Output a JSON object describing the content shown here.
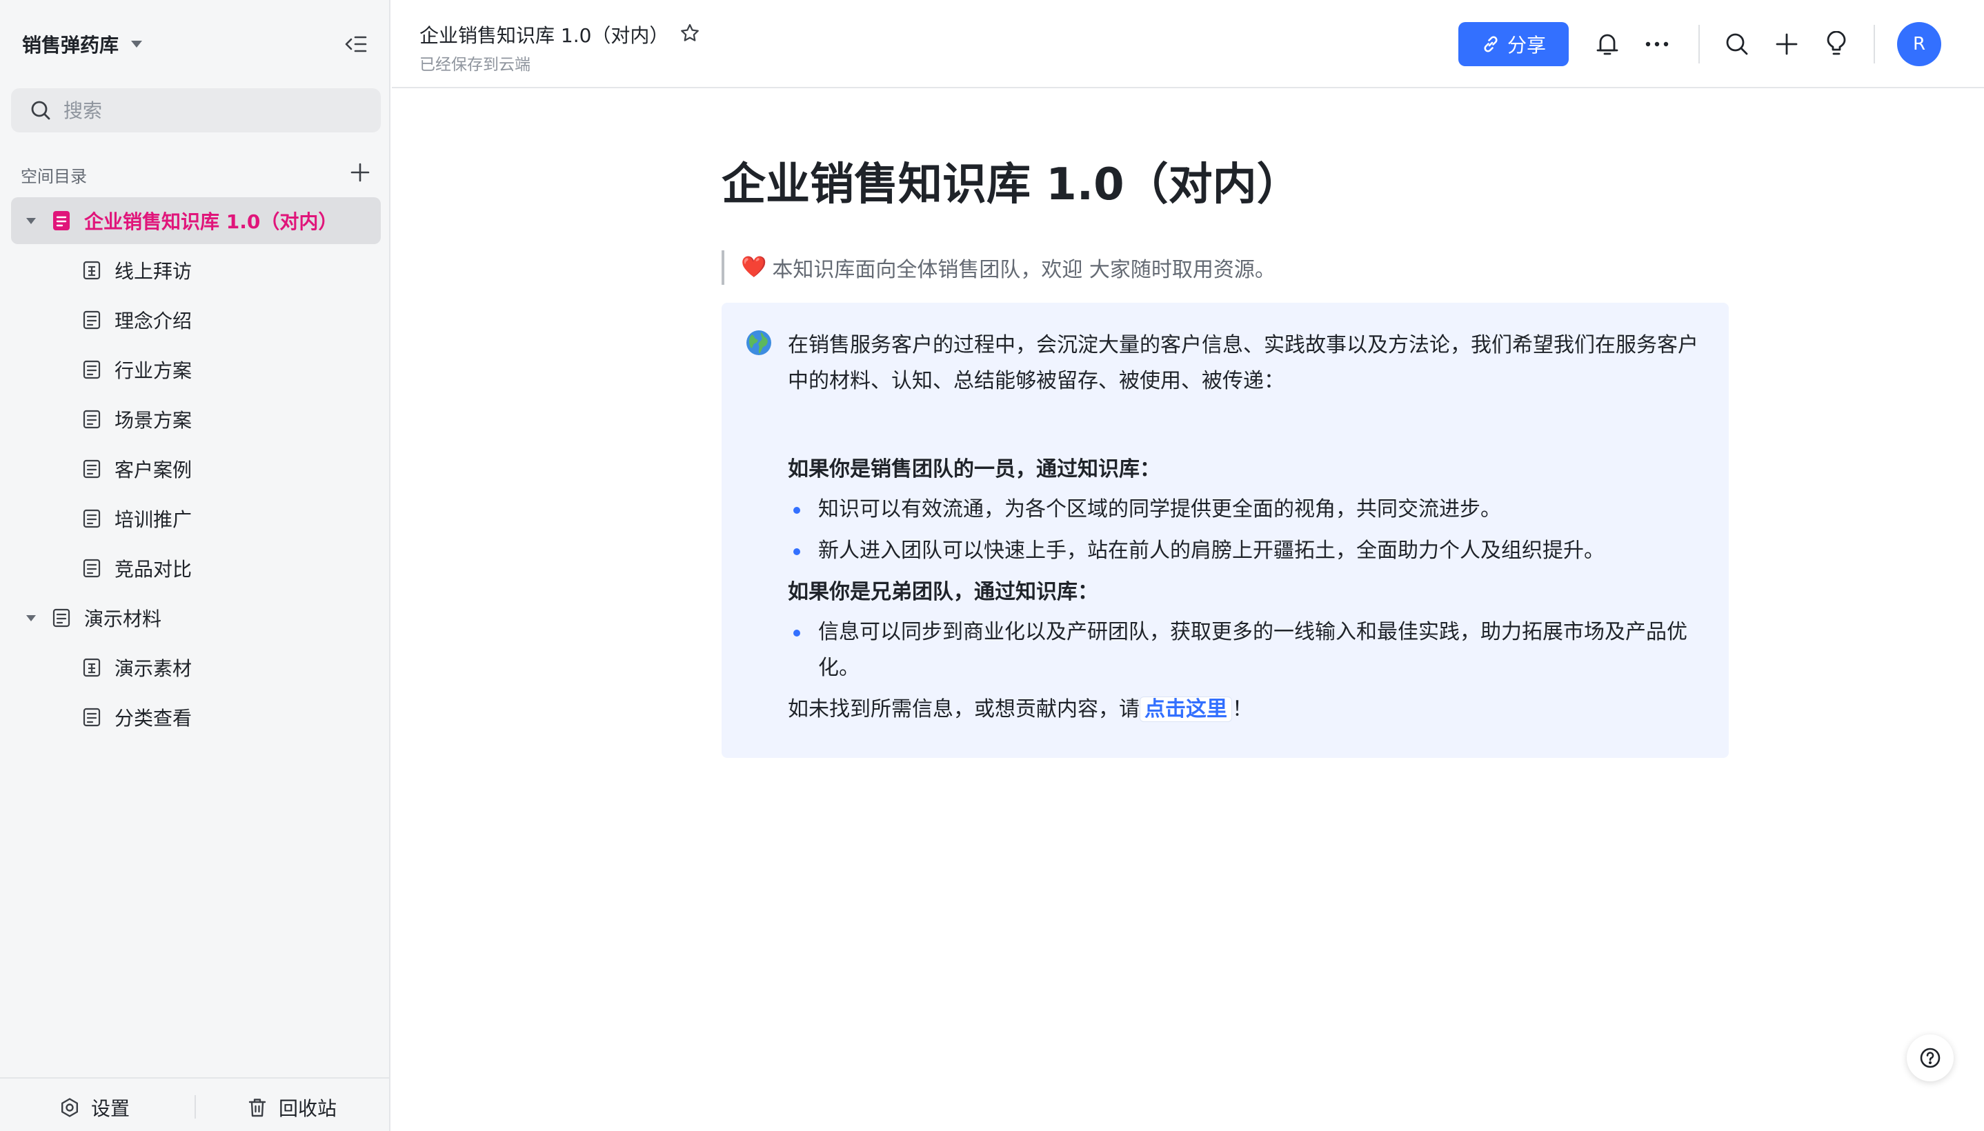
{
  "sidebar": {
    "space_name": "销售弹药库",
    "search_placeholder": "搜索",
    "directory_title": "空间目录",
    "items": [
      {
        "label": "企业销售知识库 1.0（对内）",
        "icon": "doc-pink-icon",
        "level": 0,
        "expanded": true,
        "active": true
      },
      {
        "label": "线上拜访",
        "icon": "table-icon",
        "level": 1
      },
      {
        "label": "理念介绍",
        "icon": "doc-icon",
        "level": 1
      },
      {
        "label": "行业方案",
        "icon": "doc-icon",
        "level": 1
      },
      {
        "label": "场景方案",
        "icon": "doc-icon",
        "level": 1
      },
      {
        "label": "客户案例",
        "icon": "doc-icon",
        "level": 1
      },
      {
        "label": "培训推广",
        "icon": "doc-icon",
        "level": 1
      },
      {
        "label": "竞品对比",
        "icon": "doc-icon",
        "level": 1
      },
      {
        "label": "演示材料",
        "icon": "doc-icon",
        "level": 0,
        "expanded": true
      },
      {
        "label": "演示素材",
        "icon": "table-icon",
        "level": 1
      },
      {
        "label": "分类查看",
        "icon": "doc-icon",
        "level": 1
      }
    ],
    "footer": {
      "settings_label": "设置",
      "trash_label": "回收站"
    }
  },
  "topbar": {
    "doc_title": "企业销售知识库 1.0（对内）",
    "save_status": "已经保存到云端",
    "share_label": "分享",
    "avatar_initial": "R",
    "accent_color": "#3370ff"
  },
  "document": {
    "title": "企业销售知识库 1.0（对内）",
    "quote_text": "本知识库面向全体销售团队，欢迎 大家随时取用资源。",
    "callout": {
      "intro": "在销售服务客户的过程中，会沉淀大量的客户信息、实践故事以及方法论，我们希望我们在服务客户中的材料、认知、总结能够被留存、被使用、被传递：",
      "section1_title": "如果你是销售团队的一员，通过知识库：",
      "section1_items": [
        "知识可以有效流通，为各个区域的同学提供更全面的视角，共同交流进步。",
        "新人进入团队可以快速上手，站在前人的肩膀上开疆拓土，全面助力个人及组织提升。"
      ],
      "section2_title": "如果你是兄弟团队，通过知识库：",
      "section2_items": [
        "信息可以同步到商业化以及产研团队，获取更多的一线输入和最佳实践，助力拓展市场及产品优化。"
      ],
      "footer_prefix": "如未找到所需信息，或想贡献内容，请",
      "footer_link": "点击这里",
      "footer_suffix": "！"
    }
  }
}
